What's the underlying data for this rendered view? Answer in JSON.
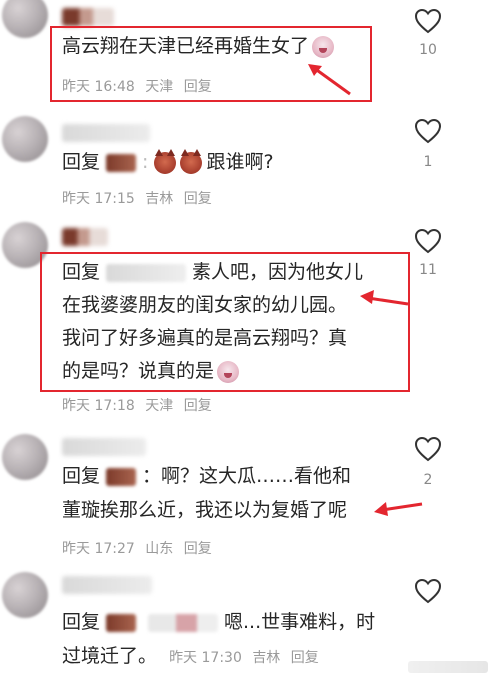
{
  "comments": [
    {
      "text": "高云翔在天津已经再婚生女了",
      "time": "昨天 16:48",
      "location": "天津",
      "reply": "回复",
      "likes": "10"
    },
    {
      "reply_prefix": "回复",
      "text": "跟谁啊?",
      "time": "昨天 17:15",
      "location": "吉林",
      "reply": "回复",
      "likes": "1"
    },
    {
      "reply_prefix": "回复",
      "lines": [
        "素人吧，因为他女儿",
        "在我婆婆朋友的闺女家的幼儿园。",
        "我问了好多遍真的是高云翔吗？真",
        "的是吗？说真的是"
      ],
      "time": "昨天 17:18",
      "location": "天津",
      "reply": "回复",
      "likes": "11"
    },
    {
      "reply_prefix": "回复",
      "lines": [
        "：啊？这大瓜……看他和",
        "董璇挨那么近，我还以为复婚了呢"
      ],
      "time": "昨天 17:27",
      "location": "山东",
      "reply": "回复",
      "likes": "2"
    },
    {
      "reply_prefix": "回复",
      "line1": "嗯...世事难料，时",
      "line2": "过境迁了。",
      "time": "昨天 17:30",
      "location": "吉林",
      "reply": "回复"
    }
  ],
  "colors": {
    "highlight": "#e3262f",
    "meta": "#9a9a9a",
    "text": "#262626"
  },
  "icons": [
    "heart-outline-icon",
    "crying-emoji-icon",
    "devil-emoji-icon",
    "red-arrow"
  ]
}
